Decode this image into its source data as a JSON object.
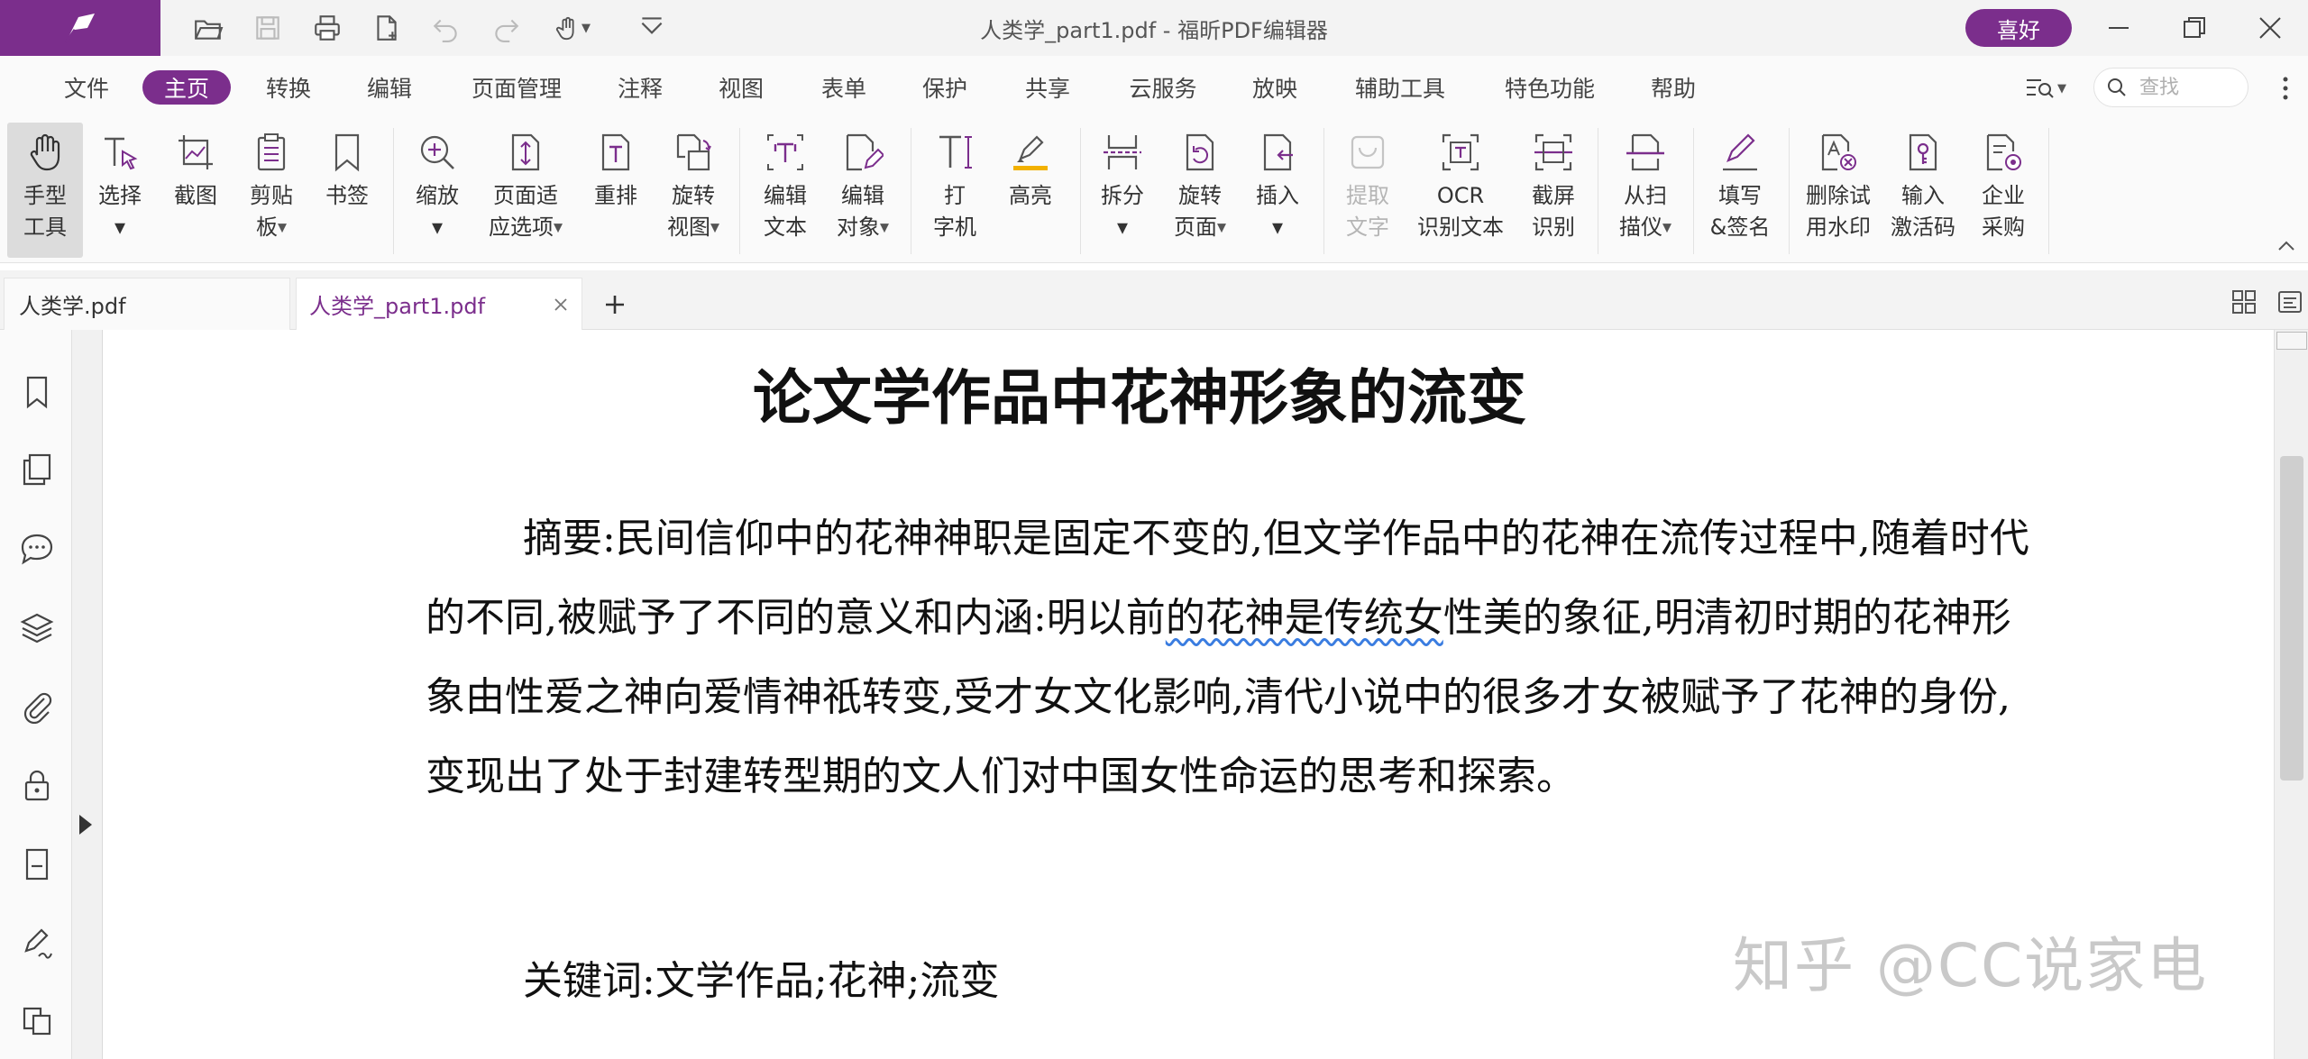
{
  "window": {
    "title": "人类学_part1.pdf - 福昕PDF编辑器",
    "favorite_label": "喜好"
  },
  "menu": {
    "items": [
      {
        "label": "文件"
      },
      {
        "label": "主页",
        "active": true
      },
      {
        "label": "转换"
      },
      {
        "label": "编辑"
      },
      {
        "label": "页面管理"
      },
      {
        "label": "注释"
      },
      {
        "label": "视图"
      },
      {
        "label": "表单"
      },
      {
        "label": "保护"
      },
      {
        "label": "共享"
      },
      {
        "label": "云服务"
      },
      {
        "label": "放映"
      },
      {
        "label": "辅助工具"
      },
      {
        "label": "特色功能"
      },
      {
        "label": "帮助"
      }
    ],
    "search_placeholder": "查找"
  },
  "ribbon": {
    "tools": [
      {
        "line1": "手型",
        "line2": "工具",
        "icon": "hand-icon",
        "selected": true
      },
      {
        "line1": "选择",
        "line2": "▾",
        "icon": "select-text-icon"
      },
      {
        "line1": "截图",
        "line2": "",
        "icon": "snapshot-icon"
      },
      {
        "line1": "剪贴",
        "line2": "板",
        "icon": "clipboard-icon",
        "dropdown": true
      },
      {
        "line1": "书签",
        "line2": "",
        "icon": "bookmark-icon"
      },
      {
        "line1": "缩放",
        "line2": "▾",
        "icon": "zoom-icon"
      },
      {
        "line1": "页面适",
        "line2": "应选项",
        "icon": "fit-page-icon",
        "dropdown": true
      },
      {
        "line1": "重排",
        "line2": "",
        "icon": "reflow-icon"
      },
      {
        "line1": "旋转",
        "line2": "视图",
        "icon": "rotate-view-icon",
        "dropdown": true
      },
      {
        "line1": "编辑",
        "line2": "文本",
        "icon": "edit-text-icon"
      },
      {
        "line1": "编辑",
        "line2": "对象",
        "icon": "edit-object-icon",
        "dropdown": true
      },
      {
        "line1": "打",
        "line2": "字机",
        "icon": "typewriter-icon"
      },
      {
        "line1": "高亮",
        "line2": "",
        "icon": "highlight-icon"
      },
      {
        "line1": "拆分",
        "line2": "▾",
        "icon": "split-icon"
      },
      {
        "line1": "旋转",
        "line2": "页面",
        "icon": "rotate-page-icon",
        "dropdown": true
      },
      {
        "line1": "插入",
        "line2": "▾",
        "icon": "insert-icon"
      },
      {
        "line1": "提取",
        "line2": "文字",
        "icon": "extract-text-icon",
        "disabled": true
      },
      {
        "line1": "OCR",
        "line2": "识别文本",
        "icon": "ocr-icon"
      },
      {
        "line1": "截屏",
        "line2": "识别",
        "icon": "screen-capture-icon"
      },
      {
        "line1": "从扫",
        "line2": "描仪",
        "icon": "scanner-icon",
        "dropdown": true
      },
      {
        "line1": "填写",
        "line2": "&签名",
        "icon": "fill-sign-icon"
      },
      {
        "line1": "删除试",
        "line2": "用水印",
        "icon": "remove-watermark-icon"
      },
      {
        "line1": "输入",
        "line2": "激活码",
        "icon": "activation-key-icon"
      },
      {
        "line1": "企业",
        "line2": "采购",
        "icon": "enterprise-purchase-icon"
      }
    ]
  },
  "tabs": [
    {
      "label": "人类学.pdf"
    },
    {
      "label": "人类学_part1.pdf",
      "active": true
    }
  ],
  "document": {
    "title": "论文学作品中花神形象的流变",
    "abstract_before": "摘要:民间信仰中的花神神职是固定不变的,但文学作品中的花神在流传过程中,随着时代的不同,被赋予了不同的意义和内涵:明以前",
    "abstract_flagged": "的花神是传统女",
    "abstract_after": "性美的象征,明清初时期的花神形象由性爱之神向爱情神祇转变,受才女文化影响,清代小说中的很多才女被赋予了花神的身份,变现出了处于封建转型期的文人们对中国女性命运的思考和探索。",
    "keywords": "关键词:文学作品;花神;流变",
    "watermark": "知乎 @CC说家电"
  },
  "colors": {
    "brand": "#7b2e8c",
    "spellcheck": "#3b7de0"
  }
}
